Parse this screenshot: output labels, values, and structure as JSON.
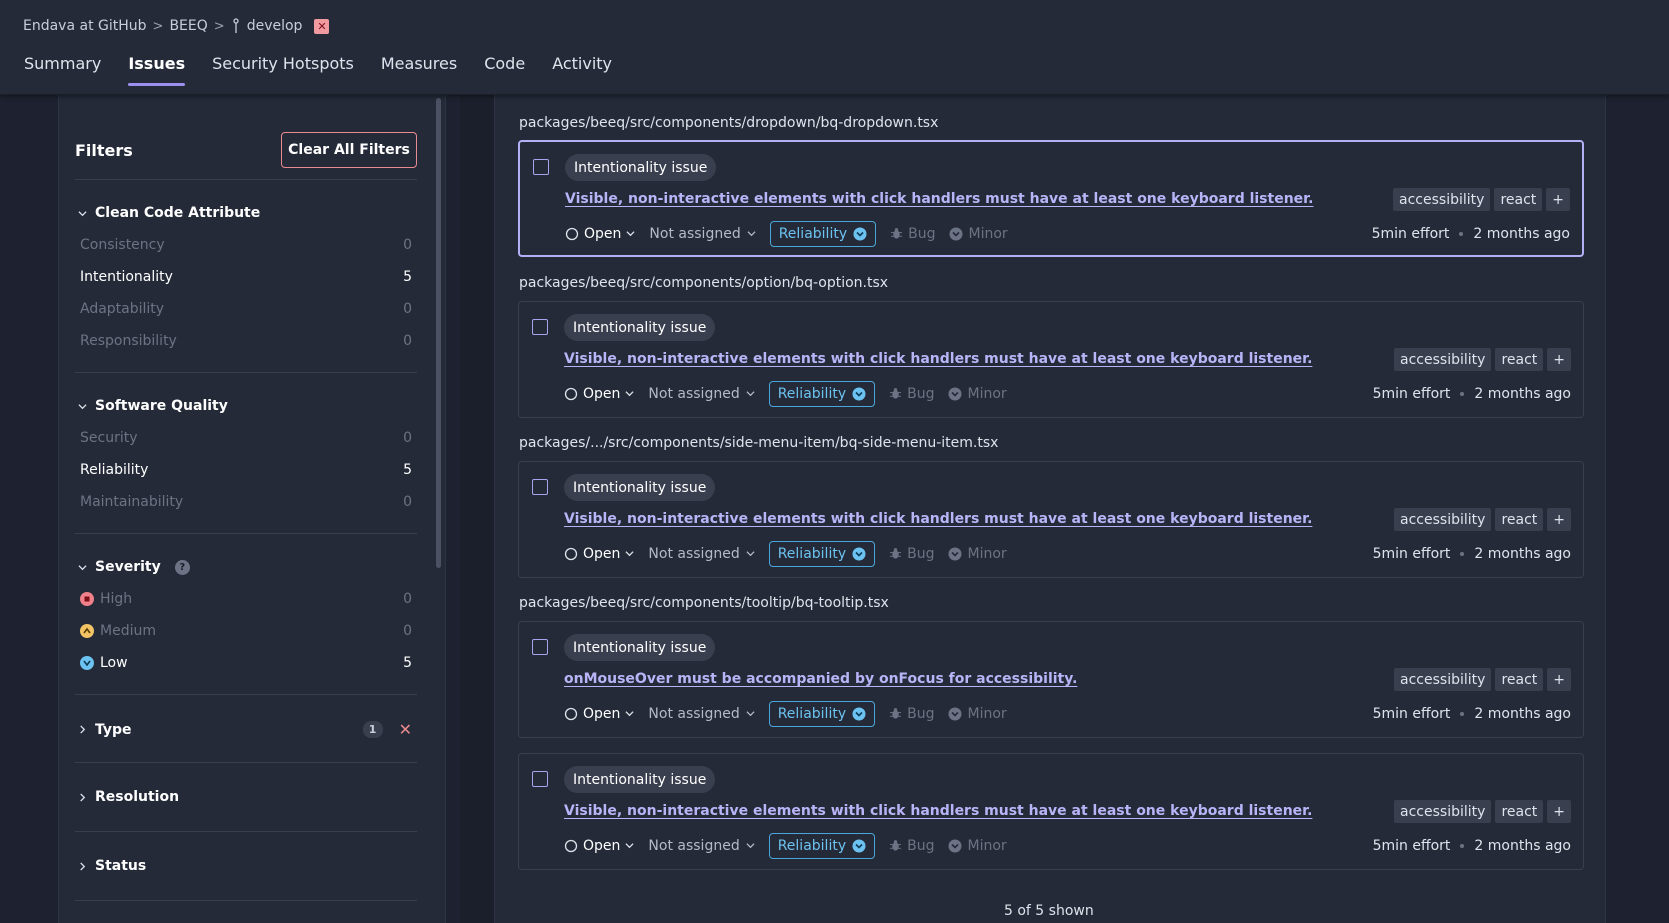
{
  "breadcrumb": {
    "org": "Endava at GitHub",
    "project": "BEEQ",
    "branch": "develop",
    "sep": ">"
  },
  "tabs": [
    {
      "label": "Summary",
      "active": false
    },
    {
      "label": "Issues",
      "active": true
    },
    {
      "label": "Security Hotspots",
      "active": false
    },
    {
      "label": "Measures",
      "active": false
    },
    {
      "label": "Code",
      "active": false
    },
    {
      "label": "Activity",
      "active": false
    }
  ],
  "filters": {
    "title": "Filters",
    "clear_label": "Clear All Filters",
    "clean_code": {
      "title": "Clean Code Attribute",
      "items": [
        {
          "label": "Consistency",
          "count": "0"
        },
        {
          "label": "Intentionality",
          "count": "5"
        },
        {
          "label": "Adaptability",
          "count": "0"
        },
        {
          "label": "Responsibility",
          "count": "0"
        }
      ]
    },
    "software_quality": {
      "title": "Software Quality",
      "items": [
        {
          "label": "Security",
          "count": "0"
        },
        {
          "label": "Reliability",
          "count": "5"
        },
        {
          "label": "Maintainability",
          "count": "0"
        }
      ]
    },
    "severity": {
      "title": "Severity",
      "help": "?",
      "items": [
        {
          "label": "High",
          "count": "0"
        },
        {
          "label": "Medium",
          "count": "0"
        },
        {
          "label": "Low",
          "count": "5"
        }
      ]
    },
    "type": {
      "title": "Type",
      "badge": "1",
      "clear": "✕"
    },
    "resolution": {
      "title": "Resolution"
    },
    "status": {
      "title": "Status"
    }
  },
  "issues": [
    {
      "path": "packages/beeq/src/components/dropdown/bq-dropdown.tsx",
      "attribute": "Intentionality issue",
      "title": "Visible, non-interactive elements with click handlers must have at least one keyboard listener.",
      "tags": [
        "accessibility",
        "react",
        "+"
      ],
      "status": "Open",
      "assignee": "Not assigned",
      "quality": "Reliability",
      "type": "Bug",
      "severity": "Minor",
      "effort": "5min effort",
      "age": "2 months ago"
    },
    {
      "path": "packages/beeq/src/components/option/bq-option.tsx",
      "attribute": "Intentionality issue",
      "title": "Visible, non-interactive elements with click handlers must have at least one keyboard listener.",
      "tags": [
        "accessibility",
        "react",
        "+"
      ],
      "status": "Open",
      "assignee": "Not assigned",
      "quality": "Reliability",
      "type": "Bug",
      "severity": "Minor",
      "effort": "5min effort",
      "age": "2 months ago"
    },
    {
      "path": "packages/.../src/components/side-menu-item/bq-side-menu-item.tsx",
      "attribute": "Intentionality issue",
      "title": "Visible, non-interactive elements with click handlers must have at least one keyboard listener.",
      "tags": [
        "accessibility",
        "react",
        "+"
      ],
      "status": "Open",
      "assignee": "Not assigned",
      "quality": "Reliability",
      "type": "Bug",
      "severity": "Minor",
      "effort": "5min effort",
      "age": "2 months ago"
    },
    {
      "path": "packages/beeq/src/components/tooltip/bq-tooltip.tsx",
      "attribute": "Intentionality issue",
      "title": "onMouseOver must be accompanied by onFocus for accessibility.",
      "tags": [
        "accessibility",
        "react",
        "+"
      ],
      "status": "Open",
      "assignee": "Not assigned",
      "quality": "Reliability",
      "type": "Bug",
      "severity": "Minor",
      "effort": "5min effort",
      "age": "2 months ago"
    },
    {
      "path": "",
      "attribute": "Intentionality issue",
      "title": "Visible, non-interactive elements with click handlers must have at least one keyboard listener.",
      "tags": [
        "accessibility",
        "react",
        "+"
      ],
      "status": "Open",
      "assignee": "Not assigned",
      "quality": "Reliability",
      "type": "Bug",
      "severity": "Minor",
      "effort": "5min effort",
      "age": "2 months ago"
    }
  ],
  "footer": {
    "shown": "5 of 5 shown"
  },
  "colors": {
    "accent": "#9b8ff0",
    "reliability": "#6cc2f0",
    "danger": "#e98a8f",
    "high": "#f0808a",
    "medium": "#f2c466",
    "low": "#6cc2f0"
  }
}
